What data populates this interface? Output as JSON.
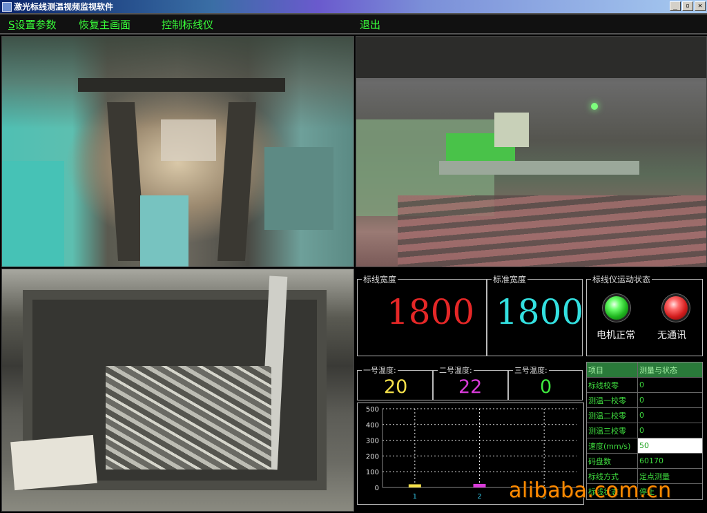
{
  "window": {
    "title": "激光标线测温视频监视软件",
    "buttons": {
      "minimize": "_",
      "restore": "▫",
      "close": "✕"
    }
  },
  "menu": {
    "settings": {
      "accel": "S",
      "label": "设置参数"
    },
    "restore_main": "恢复主画面",
    "control": "控制标线仪",
    "exit": "退出"
  },
  "readouts": {
    "marker_width": {
      "label": "标线宽度",
      "value": "1800",
      "color": "#e52727"
    },
    "standard_width": {
      "label": "标准宽度",
      "value": "1800",
      "color": "#33e0e0"
    }
  },
  "status": {
    "label": "标线仪运动状态",
    "motor": {
      "label": "电机正常",
      "state": "green"
    },
    "comm": {
      "label": "无通讯",
      "state": "red"
    }
  },
  "temps": [
    {
      "label": "一号温度:",
      "value": "20",
      "color": "#f4e04a"
    },
    {
      "label": "二号温度:",
      "value": "22",
      "color": "#d93ad9"
    },
    {
      "label": "三号温度:",
      "value": "0",
      "color": "#3ee83e"
    }
  ],
  "params": {
    "header": {
      "name": "项目",
      "value": "测量与状态"
    },
    "rows": [
      {
        "name": "标线校零",
        "value": "0"
      },
      {
        "name": "测温一校零",
        "value": "0"
      },
      {
        "name": "测温二校零",
        "value": "0"
      },
      {
        "name": "测温三校零",
        "value": "0"
      },
      {
        "name": "速度(mm/s)",
        "value": "50",
        "active": true
      },
      {
        "name": "码盘数",
        "value": "60170"
      },
      {
        "name": "标线方式",
        "value": "定点测量"
      },
      {
        "name": "标线状态",
        "value": "停止"
      }
    ]
  },
  "watermark": "alibaba.com.cn",
  "chart_data": {
    "type": "bar",
    "categories": [
      "1",
      "2",
      "3"
    ],
    "values": [
      20,
      22,
      0
    ],
    "colors": [
      "#f4e04a",
      "#d93ad9",
      "#3ee83e"
    ],
    "ylim": [
      0,
      500
    ],
    "yticks": [
      "0",
      "100",
      "200",
      "300",
      "400",
      "500"
    ],
    "grid": true
  }
}
